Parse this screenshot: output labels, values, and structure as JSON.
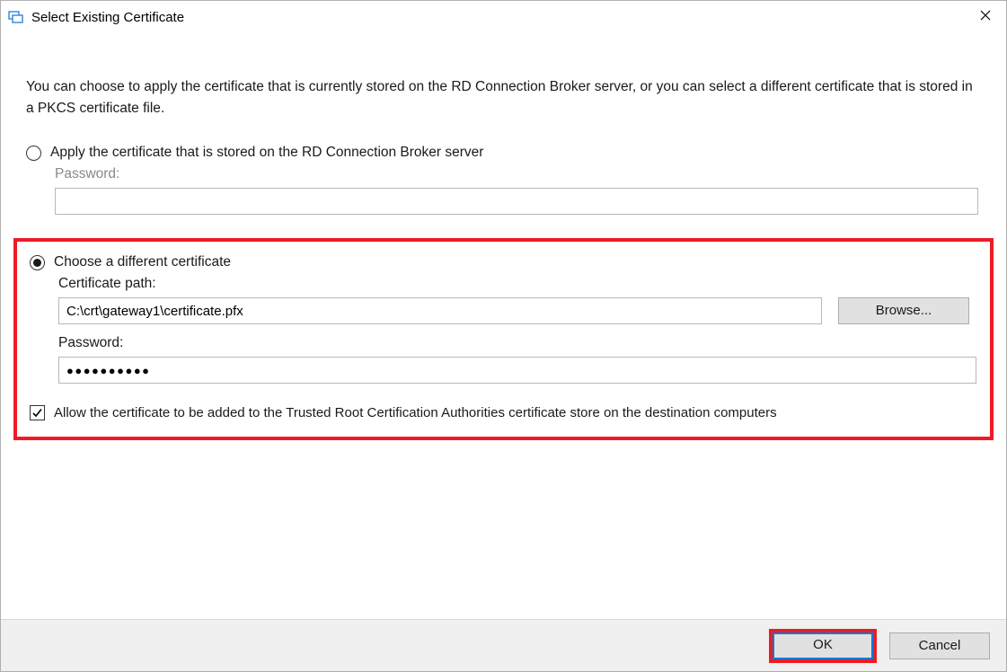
{
  "title": "Select Existing Certificate",
  "intro": "You can choose to apply the certificate that is currently stored on the RD Connection Broker server, or you can select a different certificate that is stored in a PKCS certificate file.",
  "option1": {
    "label": "Apply the certificate that is stored on the RD Connection Broker server",
    "selected": false,
    "password_label": "Password:",
    "password_value": ""
  },
  "option2": {
    "label": "Choose a different certificate",
    "selected": true,
    "path_label": "Certificate path:",
    "path_value": "C:\\crt\\gateway1\\certificate.pfx",
    "browse_label": "Browse...",
    "password_label": "Password:",
    "password_value": "●●●●●●●●●●"
  },
  "trusted_root": {
    "checked": true,
    "label": "Allow the certificate to be added to the Trusted Root Certification Authorities certificate store on the destination computers"
  },
  "buttons": {
    "ok": "OK",
    "cancel": "Cancel"
  }
}
